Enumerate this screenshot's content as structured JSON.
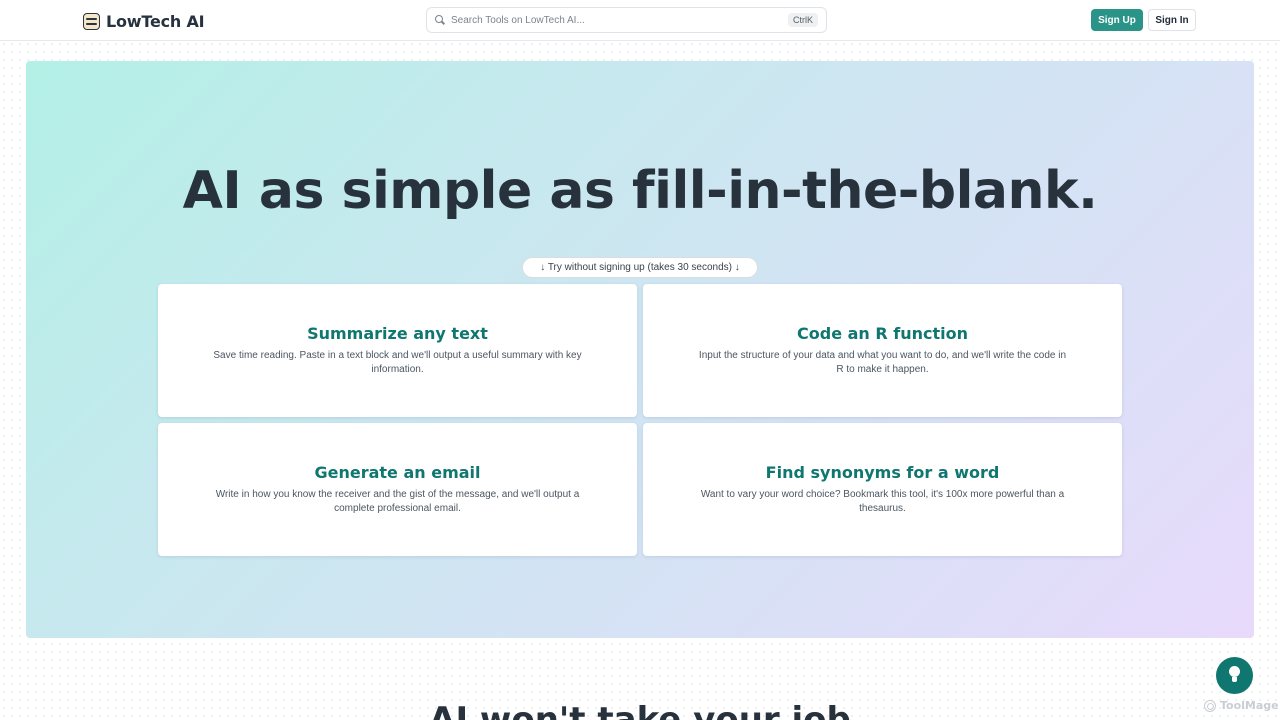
{
  "brand": {
    "name": "LowTech AI"
  },
  "search": {
    "placeholder": "Search Tools on LowTech AI...",
    "shortcut": "CtrlK"
  },
  "auth": {
    "signup_label": "Sign Up",
    "signin_label": "Sign In"
  },
  "hero": {
    "title": "AI as simple as fill-in-the-blank.",
    "try_label": "↓ Try without signing up (takes 30 seconds) ↓"
  },
  "tools": [
    {
      "title": "Summarize any text",
      "description": "Save time reading. Paste in a text block and we'll output a useful summary with key information."
    },
    {
      "title": "Code an R function",
      "description": "Input the structure of your data and what you want to do, and we'll write the code in R to make it happen."
    },
    {
      "title": "Generate an email",
      "description": "Write in how you know the receiver and the gist of the message, and we'll output a complete professional email."
    },
    {
      "title": "Find synonyms for a word",
      "description": "Want to vary your word choice? Bookmark this tool, it's 100x more powerful than a thesaurus."
    }
  ],
  "next_section": {
    "title": "AI won't take your job"
  },
  "fab": {
    "icon": "lightbulb-icon"
  },
  "watermark": {
    "text": "ToolMage"
  },
  "colors": {
    "accent": "#2a9488",
    "card_title": "#0f7670"
  }
}
